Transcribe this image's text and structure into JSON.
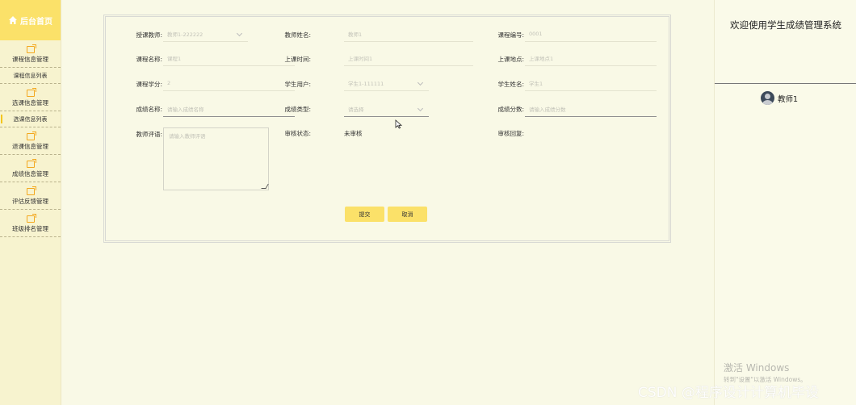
{
  "sidebar": {
    "home_label": "后台首页",
    "groups": [
      {
        "label": "课程信息管理",
        "sub": "课程信息列表"
      },
      {
        "label": "选课信息管理",
        "sub": "选课信息列表"
      },
      {
        "label": "退课信息管理"
      },
      {
        "label": "成绩信息管理"
      },
      {
        "label": "评估反馈管理"
      },
      {
        "label": "班级排名管理"
      }
    ],
    "icons": {
      "home": "home-icon",
      "menu": "folder-icon"
    }
  },
  "right_panel": {
    "welcome": "欢迎使用学生成绩管理系统",
    "username": "教师1",
    "activate_title": "激活 Windows",
    "activate_sub": "转到\"设置\"以激活 Windows。"
  },
  "form": {
    "row1": {
      "teacher_account_label": "授课教师:",
      "teacher_account_value": "教师1-222222",
      "teacher_name_label": "教师姓名:",
      "teacher_name_value": "教师1",
      "course_no_label": "课程编号:",
      "course_no_value": "0001"
    },
    "row2": {
      "course_name_label": "课程名称:",
      "course_name_value": "课程1",
      "class_time_label": "上课时间:",
      "class_time_value": "上课时间1",
      "class_place_label": "上课地点:",
      "class_place_value": "上课地点1"
    },
    "row3": {
      "credit_label": "课程学分:",
      "credit_value": "2",
      "student_user_label": "学生用户:",
      "student_user_value": "学生1-111111",
      "student_name_label": "学生姓名:",
      "student_name_value": "学生1"
    },
    "row4": {
      "score_name_label": "成绩名称:",
      "score_name_placeholder": "请输入成绩名称",
      "score_type_label": "成绩类型:",
      "score_type_placeholder": "请选择",
      "score_value_label": "成绩分数:",
      "score_value_placeholder": "请输入成绩分数"
    },
    "row5": {
      "comment_label": "教师评语:",
      "comment_placeholder": "请输入教师评语",
      "audit_status_label": "审核状态:",
      "audit_status_value": "未审核",
      "audit_reply_label": "审核回复:"
    },
    "submit_label": "提交",
    "cancel_label": "取消"
  },
  "watermark": "CSDN @程序设计计算机毕设"
}
